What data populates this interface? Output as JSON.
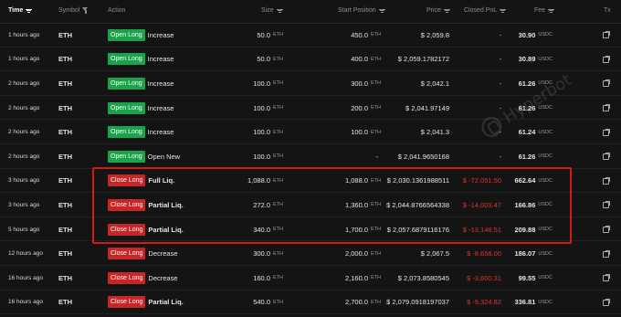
{
  "headers": {
    "time": "Time",
    "symbol": "Symbol",
    "action": "Action",
    "size": "Size",
    "start_position": "Start Position",
    "price": "Price",
    "closed_pnl": "Closed PnL",
    "fee": "Fee",
    "tx": "Tx"
  },
  "watermark": "Hyperbot",
  "rows": [
    {
      "time": "1 hours ago",
      "symbol": "ETH",
      "badge": "Open Long",
      "badge_type": "open",
      "action": "Increase",
      "size": "50.0",
      "size_unit": "ETH",
      "start": "450.0",
      "start_unit": "ETH",
      "price": "$ 2,059.8",
      "pnl": "-",
      "fee": "30.90",
      "fee_unit": "USDC"
    },
    {
      "time": "1 hours ago",
      "symbol": "ETH",
      "badge": "Open Long",
      "badge_type": "open",
      "action": "Increase",
      "size": "50.0",
      "size_unit": "ETH",
      "start": "400.0",
      "start_unit": "ETH",
      "price": "$ 2,059.1782172",
      "pnl": "-",
      "fee": "30.89",
      "fee_unit": "USDC"
    },
    {
      "time": "2 hours ago",
      "symbol": "ETH",
      "badge": "Open Long",
      "badge_type": "open",
      "action": "Increase",
      "size": "100.0",
      "size_unit": "ETH",
      "start": "300.0",
      "start_unit": "ETH",
      "price": "$ 2,042.1",
      "pnl": "-",
      "fee": "61.26",
      "fee_unit": "USDC"
    },
    {
      "time": "2 hours ago",
      "symbol": "ETH",
      "badge": "Open Long",
      "badge_type": "open",
      "action": "Increase",
      "size": "100.0",
      "size_unit": "ETH",
      "start": "200.0",
      "start_unit": "ETH",
      "price": "$ 2,041.97149",
      "pnl": "-",
      "fee": "61.26",
      "fee_unit": "USDC"
    },
    {
      "time": "2 hours ago",
      "symbol": "ETH",
      "badge": "Open Long",
      "badge_type": "open",
      "action": "Increase",
      "size": "100.0",
      "size_unit": "ETH",
      "start": "100.0",
      "start_unit": "ETH",
      "price": "$ 2,041.3",
      "pnl": "-",
      "fee": "61.24",
      "fee_unit": "USDC"
    },
    {
      "time": "2 hours ago",
      "symbol": "ETH",
      "badge": "Open Long",
      "badge_type": "open",
      "action": "Open New",
      "size": "100.0",
      "size_unit": "ETH",
      "start": "-",
      "start_unit": "",
      "price": "$ 2,041.9650168",
      "pnl": "-",
      "fee": "61.26",
      "fee_unit": "USDC"
    },
    {
      "time": "3 hours ago",
      "symbol": "ETH",
      "badge": "Close Long",
      "badge_type": "close",
      "action": "Full Liq.",
      "size": "1,088.0",
      "size_unit": "ETH",
      "start": "1,088.0",
      "start_unit": "ETH",
      "price": "$ 2,030.1361988511",
      "pnl": "$ -72,051.50",
      "fee": "662.64",
      "fee_unit": "USDC"
    },
    {
      "time": "3 hours ago",
      "symbol": "ETH",
      "badge": "Close Long",
      "badge_type": "close",
      "action": "Partial Liq.",
      "size": "272.0",
      "size_unit": "ETH",
      "start": "1,360.0",
      "start_unit": "ETH",
      "price": "$ 2,044.8766564338",
      "pnl": "$ -14,003.47",
      "fee": "166.86",
      "fee_unit": "USDC"
    },
    {
      "time": "5 hours ago",
      "symbol": "ETH",
      "badge": "Close Long",
      "badge_type": "close",
      "action": "Partial Liq.",
      "size": "340.0",
      "size_unit": "ETH",
      "start": "1,700.0",
      "start_unit": "ETH",
      "price": "$ 2,057.6879116176",
      "pnl": "$ -13,148.51",
      "fee": "209.88",
      "fee_unit": "USDC"
    },
    {
      "time": "12 hours ago",
      "symbol": "ETH",
      "badge": "Close Long",
      "badge_type": "close",
      "action": "Decrease",
      "size": "300.0",
      "size_unit": "ETH",
      "start": "2,000.0",
      "start_unit": "ETH",
      "price": "$ 2,067.5",
      "pnl": "$ -8,658.00",
      "fee": "186.07",
      "fee_unit": "USDC"
    },
    {
      "time": "16 hours ago",
      "symbol": "ETH",
      "badge": "Close Long",
      "badge_type": "close",
      "action": "Decrease",
      "size": "160.0",
      "size_unit": "ETH",
      "start": "2,160.0",
      "start_unit": "ETH",
      "price": "$ 2,073.8580545",
      "pnl": "$ -3,600.31",
      "fee": "99.55",
      "fee_unit": "USDC"
    },
    {
      "time": "16 hours ago",
      "symbol": "ETH",
      "badge": "Close Long",
      "badge_type": "close",
      "action": "Partial Liq.",
      "size": "540.0",
      "size_unit": "ETH",
      "start": "2,700.0",
      "start_unit": "ETH",
      "price": "$ 2,079.0918197037",
      "pnl": "$ -9,324.82",
      "fee": "336.81",
      "fee_unit": "USDC"
    }
  ],
  "colors": {
    "background": "#141414",
    "open_badge": "#1aa34a",
    "close_badge": "#c72526",
    "negative_pnl": "#e2322e",
    "highlight_box": "#d21a1a"
  },
  "icons": {
    "sort": "sort-icon",
    "filter": "filter-icon",
    "tx_link": "external-link-icon"
  }
}
